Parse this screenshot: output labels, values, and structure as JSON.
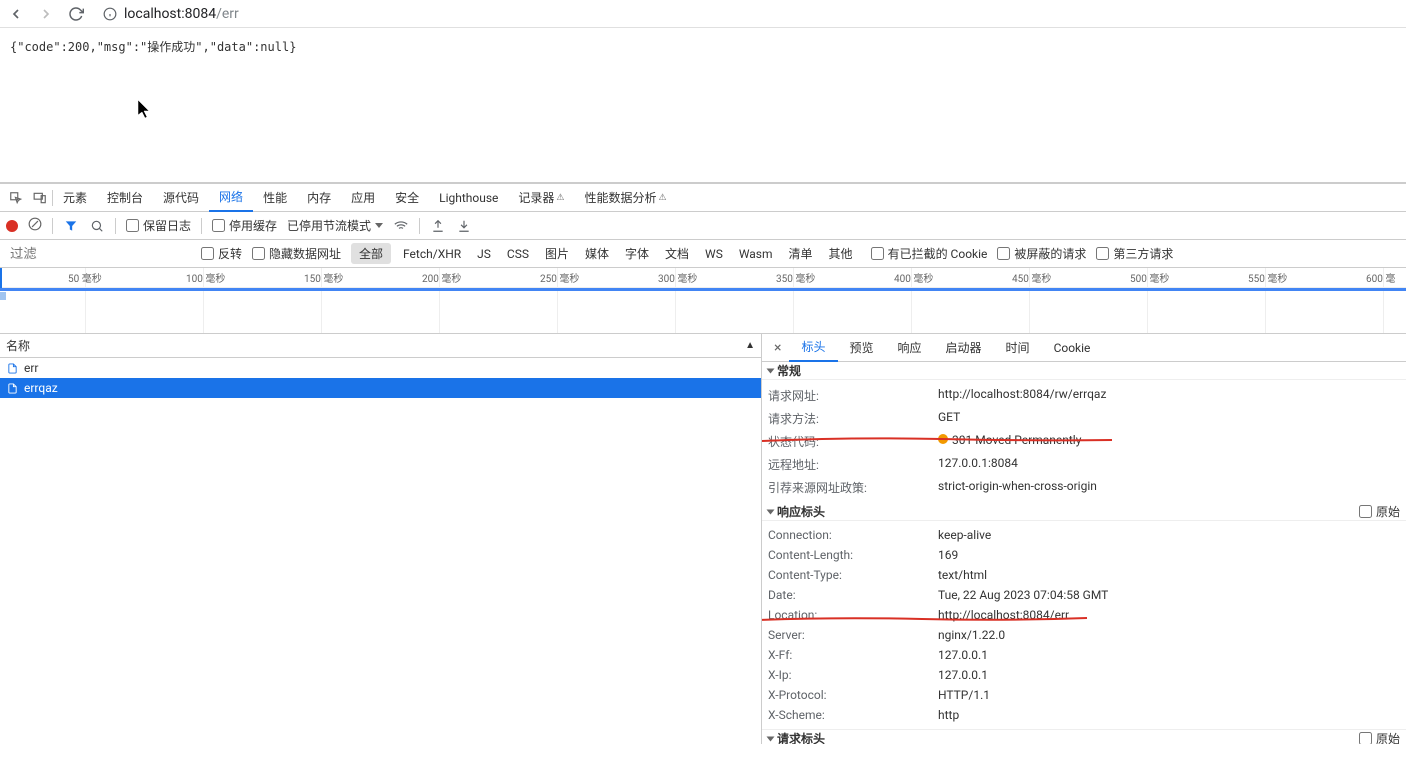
{
  "url": {
    "host": "localhost:8084",
    "path": "/err"
  },
  "pageBody": "{\"code\":200,\"msg\":\"操作成功\",\"data\":null}",
  "devtoolsTabs": {
    "elements": "元素",
    "console": "控制台",
    "sources": "源代码",
    "network": "网络",
    "performance": "性能",
    "memory": "内存",
    "application": "应用",
    "security": "安全",
    "lighthouse": "Lighthouse",
    "recorder": "记录器",
    "perfInsights": "性能数据分析"
  },
  "toolbar": {
    "preserveLog": "保留日志",
    "disableCache": "停用缓存",
    "throttling": "已停用节流模式"
  },
  "filterRow": {
    "placeholder": "过滤",
    "invert": "反转",
    "hideDataUrls": "隐藏数据网址",
    "all": "全部",
    "fetchXhr": "Fetch/XHR",
    "js": "JS",
    "css": "CSS",
    "img": "图片",
    "media": "媒体",
    "font": "字体",
    "doc": "文档",
    "ws": "WS",
    "wasm": "Wasm",
    "manifest": "清单",
    "other": "其他",
    "blockedCookies": "有已拦截的 Cookie",
    "blockedRequests": "被屏蔽的请求",
    "thirdParty": "第三方请求"
  },
  "timeline": {
    "ticks": [
      "50 毫秒",
      "100 毫秒",
      "150 毫秒",
      "200 毫秒",
      "250 毫秒",
      "300 毫秒",
      "350 毫秒",
      "400 毫秒",
      "450 毫秒",
      "500 毫秒",
      "550 毫秒",
      "600 毫"
    ]
  },
  "listHeader": "名称",
  "requests": [
    {
      "name": "err"
    },
    {
      "name": "errqaz"
    }
  ],
  "detailsTabs": {
    "headers": "标头",
    "preview": "预览",
    "response": "响应",
    "initiator": "启动器",
    "timing": "时间",
    "cookies": "Cookie"
  },
  "general": {
    "title": "常规",
    "requestUrlLabel": "请求网址:",
    "requestUrl": "http://localhost:8084/rw/errqaz",
    "requestMethodLabel": "请求方法:",
    "requestMethod": "GET",
    "statusCodeLabel": "状态代码:",
    "statusCode": "301 Moved Permanently",
    "remoteAddressLabel": "远程地址:",
    "remoteAddress": "127.0.0.1:8084",
    "referrerPolicyLabel": "引荐来源网址政策:",
    "referrerPolicy": "strict-origin-when-cross-origin"
  },
  "responseHeaders": {
    "title": "响应标头",
    "rawLabel": "原始",
    "items": [
      {
        "k": "Connection:",
        "v": "keep-alive"
      },
      {
        "k": "Content-Length:",
        "v": "169"
      },
      {
        "k": "Content-Type:",
        "v": "text/html"
      },
      {
        "k": "Date:",
        "v": "Tue, 22 Aug 2023 07:04:58 GMT"
      },
      {
        "k": "Location:",
        "v": "http://localhost:8084/err"
      },
      {
        "k": "Server:",
        "v": "nginx/1.22.0"
      },
      {
        "k": "X-Ff:",
        "v": "127.0.0.1"
      },
      {
        "k": "X-Ip:",
        "v": "127.0.0.1"
      },
      {
        "k": "X-Protocol:",
        "v": "HTTP/1.1"
      },
      {
        "k": "X-Scheme:",
        "v": "http"
      }
    ]
  },
  "requestHeaders": {
    "title": "请求标头",
    "rawLabel": "原始"
  }
}
